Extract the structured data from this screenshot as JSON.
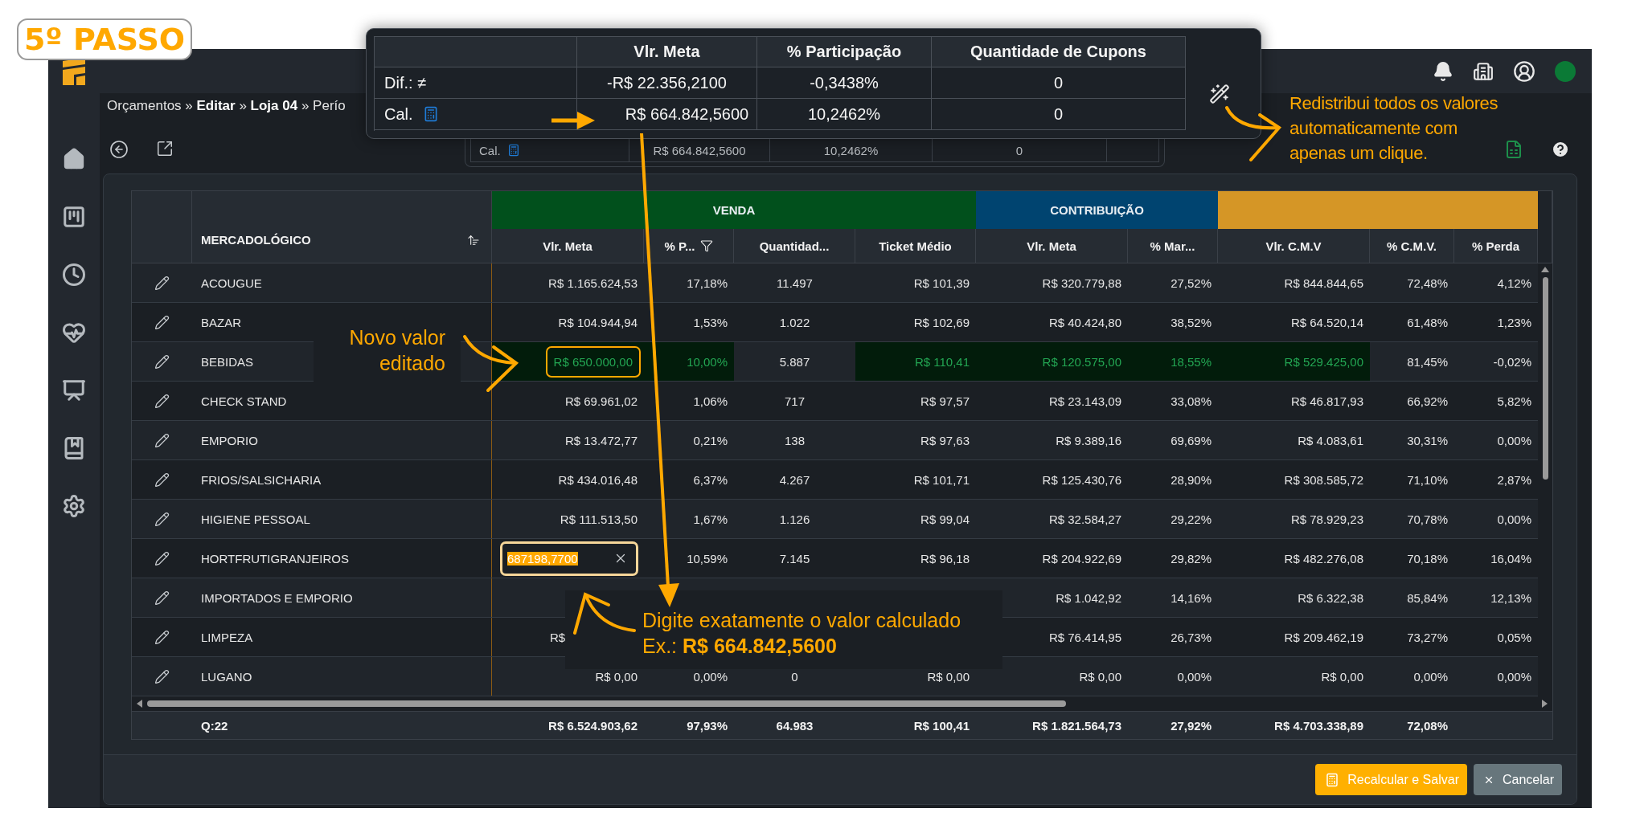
{
  "badge": "5º PASSO",
  "breadcrumb": "Orçamentos » **Editar** » **Loja 04** » Perío",
  "calc_card": {
    "label": "Cal.",
    "cells": [
      "R$ 664.842,5600",
      "10,2462%",
      "0"
    ]
  },
  "popup": {
    "columns": [
      "Vlr. Meta",
      "% Participação",
      "Quantidade de Cupons"
    ],
    "rows": [
      {
        "kind": "difference",
        "label": "Dif.: ≠",
        "cells": [
          "-R$ 22.356,2100",
          "-0,3438%",
          "0"
        ]
      },
      {
        "kind": "calculated",
        "label": "Cal.",
        "cells": [
          "R$ 664.842,5600",
          "10,2462%",
          "0"
        ]
      }
    ]
  },
  "table": {
    "name_column": {
      "label": "MERCADOLÓGICO",
      "sort": true
    },
    "groups": [
      {
        "label": "VENDA",
        "color": "#01501c",
        "columns": [
          {
            "label": "Vlr. Meta",
            "filter": false
          },
          {
            "label": "% P...",
            "filter": true
          },
          {
            "label": "Quantidad...",
            "filter": false
          },
          {
            "label": "Ticket Médio",
            "filter": false
          }
        ]
      },
      {
        "label": "CONTRIBUIÇÃO",
        "color": "#004470",
        "columns": [
          {
            "label": "Vlr. Meta",
            "filter": false
          },
          {
            "label": "% Mar...",
            "filter": false
          }
        ]
      },
      {
        "color": "#d59626",
        "columns": [
          {
            "label": "Vlr. C.M.V",
            "filter": false
          },
          {
            "label": "% C.M.V.",
            "filter": false
          },
          {
            "label": "% Perda",
            "filter": false
          }
        ]
      }
    ],
    "rows": [
      {
        "name": "ACOUGUE",
        "cells": [
          {
            "kind": "value",
            "text": "R$ 1.165.624,53",
            "changed": false
          },
          {
            "kind": "value",
            "text": "17,18%",
            "changed": false
          },
          {
            "kind": "value",
            "text": "11.497",
            "changed": false
          },
          {
            "kind": "value",
            "text": "R$ 101,39",
            "changed": false
          },
          {
            "kind": "value",
            "text": "R$ 320.779,88",
            "changed": false
          },
          {
            "kind": "value",
            "text": "27,52%",
            "changed": false
          },
          {
            "kind": "value",
            "text": "R$ 844.844,65",
            "changed": false
          },
          {
            "kind": "value",
            "text": "72,48%",
            "changed": false
          },
          {
            "kind": "value",
            "text": "4,12%",
            "changed": false
          }
        ]
      },
      {
        "name": "BAZAR",
        "cells": [
          {
            "kind": "value",
            "text": "R$ 104.944,94",
            "changed": false
          },
          {
            "kind": "value",
            "text": "1,53%",
            "changed": false
          },
          {
            "kind": "value",
            "text": "1.022",
            "changed": false
          },
          {
            "kind": "value",
            "text": "R$ 102,69",
            "changed": false
          },
          {
            "kind": "value",
            "text": "R$ 40.424,80",
            "changed": false
          },
          {
            "kind": "value",
            "text": "38,52%",
            "changed": false
          },
          {
            "kind": "value",
            "text": "R$ 64.520,14",
            "changed": false
          },
          {
            "kind": "value",
            "text": "61,48%",
            "changed": false
          },
          {
            "kind": "value",
            "text": "1,23%",
            "changed": false
          }
        ]
      },
      {
        "name": "BEBIDAS",
        "cells": [
          {
            "kind": "outlined",
            "text": "R$ 650.000,00",
            "changed": true
          },
          {
            "kind": "value",
            "text": "10,00%",
            "changed": true
          },
          {
            "kind": "value",
            "text": "5.887",
            "changed": false
          },
          {
            "kind": "value",
            "text": "R$ 110,41",
            "changed": true
          },
          {
            "kind": "value",
            "text": "R$ 120.575,00",
            "changed": true
          },
          {
            "kind": "value",
            "text": "18,55%",
            "changed": true
          },
          {
            "kind": "value",
            "text": "R$ 529.425,00",
            "changed": true
          },
          {
            "kind": "value",
            "text": "81,45%",
            "changed": false
          },
          {
            "kind": "value",
            "text": "-0,02%",
            "changed": false
          }
        ]
      },
      {
        "name": "CHECK STAND",
        "cells": [
          {
            "kind": "value",
            "text": "R$ 69.961,02",
            "changed": false
          },
          {
            "kind": "value",
            "text": "1,06%",
            "changed": false
          },
          {
            "kind": "value",
            "text": "717",
            "changed": false
          },
          {
            "kind": "value",
            "text": "R$ 97,57",
            "changed": false
          },
          {
            "kind": "value",
            "text": "R$ 23.143,09",
            "changed": false
          },
          {
            "kind": "value",
            "text": "33,08%",
            "changed": false
          },
          {
            "kind": "value",
            "text": "R$ 46.817,93",
            "changed": false
          },
          {
            "kind": "value",
            "text": "66,92%",
            "changed": false
          },
          {
            "kind": "value",
            "text": "5,82%",
            "changed": false
          }
        ]
      },
      {
        "name": "EMPORIO",
        "cells": [
          {
            "kind": "value",
            "text": "R$ 13.472,77",
            "changed": false
          },
          {
            "kind": "value",
            "text": "0,21%",
            "changed": false
          },
          {
            "kind": "value",
            "text": "138",
            "changed": false
          },
          {
            "kind": "value",
            "text": "R$ 97,63",
            "changed": false
          },
          {
            "kind": "value",
            "text": "R$ 9.389,16",
            "changed": false
          },
          {
            "kind": "value",
            "text": "69,69%",
            "changed": false
          },
          {
            "kind": "value",
            "text": "R$ 4.083,61",
            "changed": false
          },
          {
            "kind": "value",
            "text": "30,31%",
            "changed": false
          },
          {
            "kind": "value",
            "text": "0,00%",
            "changed": false
          }
        ]
      },
      {
        "name": "FRIOS/SALSICHARIA",
        "cells": [
          {
            "kind": "value",
            "text": "R$ 434.016,48",
            "changed": false
          },
          {
            "kind": "value",
            "text": "6,37%",
            "changed": false
          },
          {
            "kind": "value",
            "text": "4.267",
            "changed": false
          },
          {
            "kind": "value",
            "text": "R$ 101,71",
            "changed": false
          },
          {
            "kind": "value",
            "text": "R$ 125.430,76",
            "changed": false
          },
          {
            "kind": "value",
            "text": "28,90%",
            "changed": false
          },
          {
            "kind": "value",
            "text": "R$ 308.585,72",
            "changed": false
          },
          {
            "kind": "value",
            "text": "71,10%",
            "changed": false
          },
          {
            "kind": "value",
            "text": "2,87%",
            "changed": false
          }
        ]
      },
      {
        "name": "HIGIENE PESSOAL",
        "cells": [
          {
            "kind": "value",
            "text": "R$ 111.513,50",
            "changed": false
          },
          {
            "kind": "value",
            "text": "1,67%",
            "changed": false
          },
          {
            "kind": "value",
            "text": "1.126",
            "changed": false
          },
          {
            "kind": "value",
            "text": "R$ 99,04",
            "changed": false
          },
          {
            "kind": "value",
            "text": "R$ 32.584,27",
            "changed": false
          },
          {
            "kind": "value",
            "text": "29,22%",
            "changed": false
          },
          {
            "kind": "value",
            "text": "R$ 78.929,23",
            "changed": false
          },
          {
            "kind": "value",
            "text": "70,78%",
            "changed": false
          },
          {
            "kind": "value",
            "text": "0,00%",
            "changed": false
          }
        ]
      },
      {
        "name": "HORTFRUTIGRANJEIROS",
        "cells": [
          {
            "kind": "input",
            "text": "687198,7700",
            "changed": false
          },
          {
            "kind": "value",
            "text": "10,59%",
            "changed": false
          },
          {
            "kind": "value",
            "text": "7.145",
            "changed": false
          },
          {
            "kind": "value",
            "text": "R$ 96,18",
            "changed": false
          },
          {
            "kind": "value",
            "text": "R$ 204.922,69",
            "changed": false
          },
          {
            "kind": "value",
            "text": "29,82%",
            "changed": false
          },
          {
            "kind": "value",
            "text": "R$ 482.276,08",
            "changed": false
          },
          {
            "kind": "value",
            "text": "70,18%",
            "changed": false
          },
          {
            "kind": "value",
            "text": "16,04%",
            "changed": false
          }
        ]
      },
      {
        "name": "IMPORTADOS E EMPORIO",
        "cells": [
          null,
          null,
          null,
          null,
          {
            "kind": "value",
            "text": "R$ 1.042,92",
            "changed": false
          },
          {
            "kind": "value",
            "text": "14,16%",
            "changed": false
          },
          {
            "kind": "value",
            "text": "R$ 6.322,38",
            "changed": false
          },
          {
            "kind": "value",
            "text": "85,84%",
            "changed": false
          },
          {
            "kind": "value",
            "text": "12,13%",
            "changed": false
          }
        ]
      },
      {
        "name": "LIMPEZA",
        "cells": [
          {
            "kind": "clipped",
            "text": "R$",
            "changed": false
          },
          null,
          null,
          null,
          {
            "kind": "value",
            "text": "R$ 76.414,95",
            "changed": false
          },
          {
            "kind": "value",
            "text": "26,73%",
            "changed": false
          },
          {
            "kind": "value",
            "text": "R$ 209.462,19",
            "changed": false
          },
          {
            "kind": "value",
            "text": "73,27%",
            "changed": false
          },
          {
            "kind": "value",
            "text": "0,05%",
            "changed": false
          }
        ]
      },
      {
        "name": "LUGANO",
        "cells": [
          {
            "kind": "value",
            "text": "R$ 0,00",
            "changed": false
          },
          {
            "kind": "value",
            "text": "0,00%",
            "changed": false
          },
          {
            "kind": "value",
            "text": "0",
            "changed": false
          },
          {
            "kind": "value",
            "text": "R$ 0,00",
            "changed": false
          },
          {
            "kind": "value",
            "text": "R$ 0,00",
            "changed": false
          },
          {
            "kind": "value",
            "text": "0,00%",
            "changed": false
          },
          {
            "kind": "value",
            "text": "R$ 0,00",
            "changed": false
          },
          {
            "kind": "value",
            "text": "0,00%",
            "changed": false
          },
          {
            "kind": "value",
            "text": "0,00%",
            "changed": false
          }
        ]
      }
    ],
    "footer": {
      "count": "Q:22",
      "cells": [
        "R$ 6.524.903,62",
        "97,93%",
        "64.983",
        "R$ 100,41",
        "R$ 1.821.564,73",
        "27,92%",
        "R$ 4.703.338,89",
        "72,08%"
      ]
    }
  },
  "buttons": [
    {
      "kind": "primary",
      "label": "Recalcular e Salvar"
    },
    {
      "kind": "secondary",
      "label": "Cancelar"
    }
  ],
  "annotations": [
    {
      "kind": "redistribute",
      "lines": [
        "Redistribui todos os valores",
        "automaticamente com",
        "apenas um clique."
      ]
    },
    {
      "kind": "edited",
      "lines": [
        "Novo valor",
        "editado"
      ]
    },
    {
      "kind": "type_value",
      "lines": [
        "Digite exatamente o valor calculado",
        "Ex.: **R$ 664.842,5600**"
      ]
    }
  ]
}
